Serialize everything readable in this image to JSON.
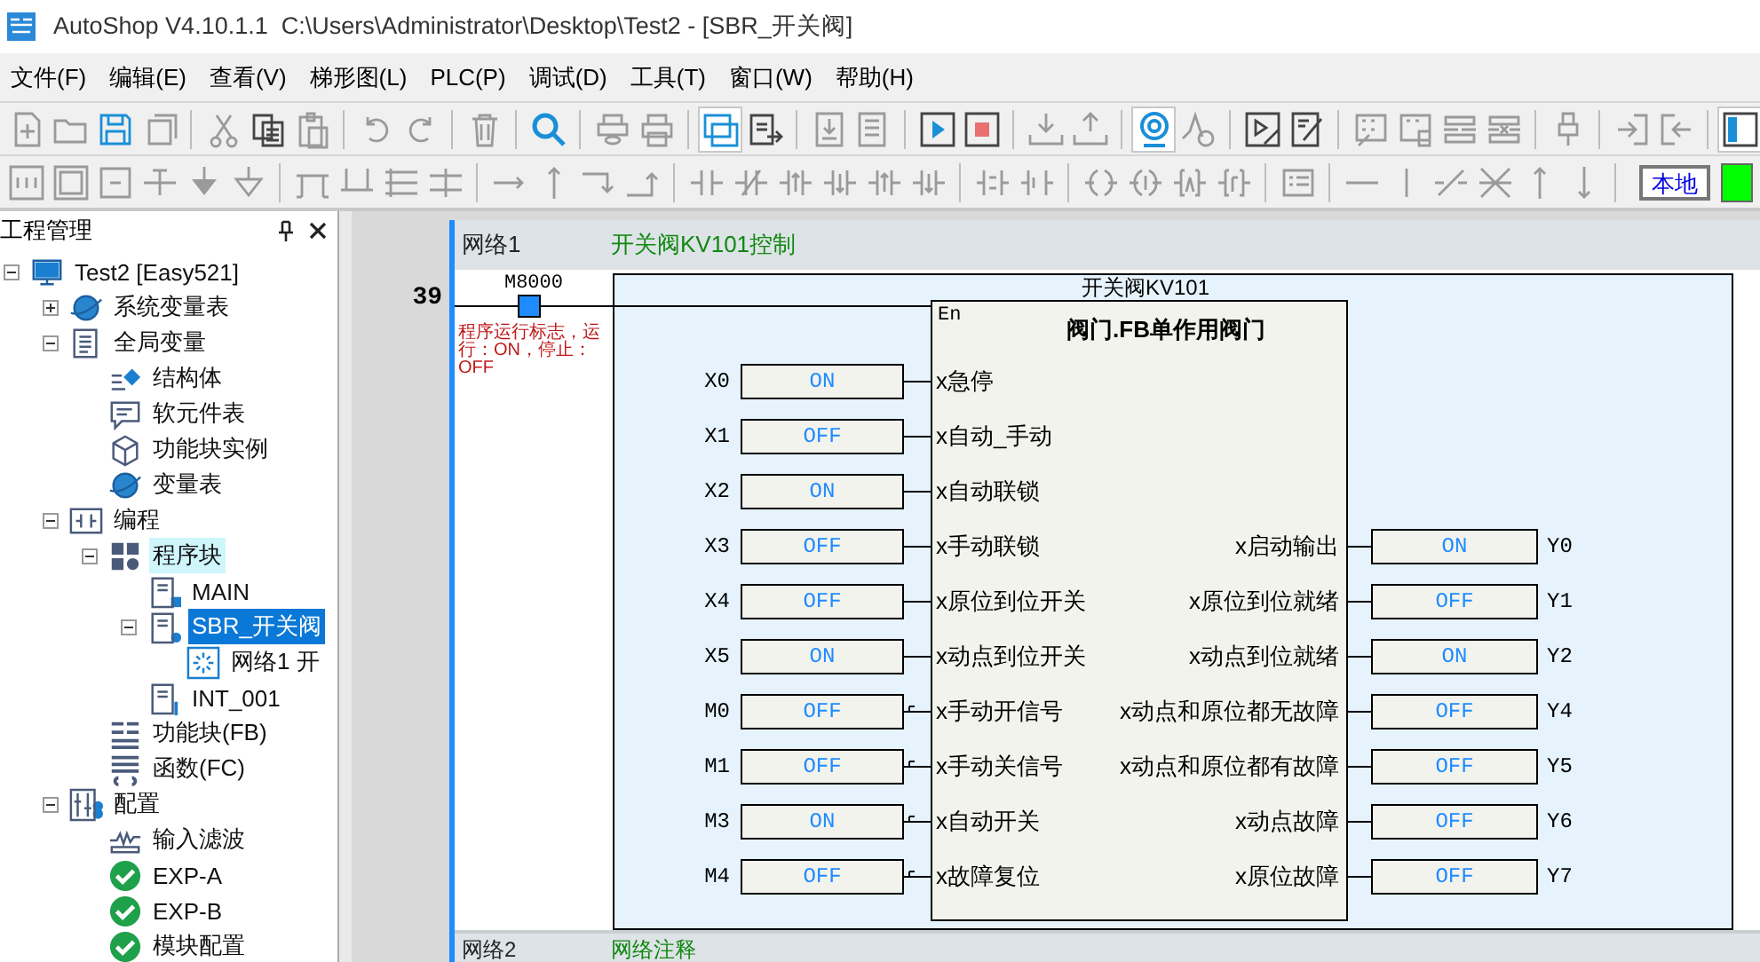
{
  "window": {
    "title": "AutoShop V4.10.1.1  C:\\Users\\Administrator\\Desktop\\Test2 - [SBR_开关阀]"
  },
  "menu": [
    "文件(F)",
    "编辑(E)",
    "查看(V)",
    "梯形图(L)",
    "PLC(P)",
    "调试(D)",
    "工具(T)",
    "窗口(W)",
    "帮助(H)"
  ],
  "toolbar": {
    "toggles": [
      {
        "pressed": true
      },
      {
        "pressed": true
      },
      {
        "pressed": true
      }
    ],
    "location_button": "本地",
    "status_lamp_on": true
  },
  "project_panel": {
    "title": "工程管理",
    "tree": [
      {
        "label": "Test2 [Easy521]",
        "kind": "project",
        "expanded": true,
        "selected": false,
        "hovered": false,
        "children": [
          {
            "label": "系统变量表",
            "kind": "var-table",
            "expanded": false,
            "selected": false,
            "hovered": false
          },
          {
            "label": "全局变量",
            "kind": "globals",
            "expanded": true,
            "selected": false,
            "hovered": false,
            "children": [
              {
                "label": "结构体",
                "kind": "struct",
                "selected": false,
                "hovered": false
              },
              {
                "label": "软元件表",
                "kind": "device-table",
                "selected": false,
                "hovered": false
              },
              {
                "label": "功能块实例",
                "kind": "fb-instance",
                "selected": false,
                "hovered": false
              },
              {
                "label": "变量表",
                "kind": "var-table",
                "selected": false,
                "hovered": false
              }
            ]
          },
          {
            "label": "编程",
            "kind": "programming",
            "expanded": true,
            "selected": false,
            "hovered": false,
            "children": [
              {
                "label": "程序块",
                "kind": "blocks",
                "expanded": true,
                "selected": false,
                "hovered": true,
                "children": [
                  {
                    "label": "MAIN",
                    "kind": "main",
                    "selected": false,
                    "hovered": false
                  },
                  {
                    "label": "SBR_开关阀",
                    "kind": "subroutine",
                    "expanded": true,
                    "selected": true,
                    "hovered": false,
                    "children": [
                      {
                        "label": "网络1 开",
                        "kind": "network",
                        "selected": false,
                        "hovered": false
                      }
                    ]
                  },
                  {
                    "label": "INT_001",
                    "kind": "interrupt",
                    "selected": false,
                    "hovered": false
                  }
                ]
              },
              {
                "label": "功能块(FB)",
                "kind": "fb",
                "selected": false,
                "hovered": false
              },
              {
                "label": "函数(FC)",
                "kind": "fc",
                "selected": false,
                "hovered": false
              }
            ]
          },
          {
            "label": "配置",
            "kind": "config",
            "expanded": true,
            "selected": false,
            "hovered": false,
            "children": [
              {
                "label": "输入滤波",
                "kind": "filter",
                "selected": false,
                "hovered": false
              },
              {
                "label": "EXP-A",
                "kind": "module",
                "selected": false,
                "hovered": false
              },
              {
                "label": "EXP-B",
                "kind": "module",
                "selected": false,
                "hovered": false
              },
              {
                "label": "模块配置",
                "kind": "module",
                "selected": false,
                "hovered": false
              }
            ]
          }
        ]
      }
    ]
  },
  "editor": {
    "row_number": "39",
    "network": {
      "label": "网络1",
      "comment": "开关阀KV101控制"
    },
    "contact": {
      "address": "M8000",
      "on": true,
      "comment": "程序运行标志，运行：ON，停止：OFF"
    },
    "function_block": {
      "instance": "开关阀KV101",
      "type": "阀门.FB单作用阀门",
      "enable_pin": "En",
      "inputs": [
        {
          "address": "X0",
          "value": "ON",
          "pin": "x急停",
          "kind": "direct"
        },
        {
          "address": "X1",
          "value": "OFF",
          "pin": "x自动_手动",
          "kind": "direct"
        },
        {
          "address": "X2",
          "value": "ON",
          "pin": "x自动联锁",
          "kind": "direct"
        },
        {
          "address": "X3",
          "value": "OFF",
          "pin": "x手动联锁",
          "kind": "direct"
        },
        {
          "address": "X4",
          "value": "OFF",
          "pin": "x原位到位开关",
          "kind": "direct"
        },
        {
          "address": "X5",
          "value": "ON",
          "pin": "x动点到位开关",
          "kind": "direct"
        },
        {
          "address": "M0",
          "value": "OFF",
          "pin": "x手动开信号",
          "kind": "relay"
        },
        {
          "address": "M1",
          "value": "OFF",
          "pin": "x手动关信号",
          "kind": "relay"
        },
        {
          "address": "M3",
          "value": "ON",
          "pin": "x自动开关",
          "kind": "relay"
        },
        {
          "address": "M4",
          "value": "OFF",
          "pin": "x故障复位",
          "kind": "relay"
        }
      ],
      "outputs": [
        {
          "pin": "x启动输出",
          "value": "ON",
          "address": "Y0"
        },
        {
          "pin": "x原位到位就绪",
          "value": "OFF",
          "address": "Y1"
        },
        {
          "pin": "x动点到位就绪",
          "value": "ON",
          "address": "Y2"
        },
        {
          "pin": "x动点和原位都无故障",
          "value": "OFF",
          "address": "Y4"
        },
        {
          "pin": "x动点和原位都有故障",
          "value": "OFF",
          "address": "Y5"
        },
        {
          "pin": "x动点故障",
          "value": "OFF",
          "address": "Y6"
        },
        {
          "pin": "x原位故障",
          "value": "OFF",
          "address": "Y7"
        }
      ]
    },
    "next_network": {
      "label": "网络2",
      "comment": "网络注释"
    }
  }
}
